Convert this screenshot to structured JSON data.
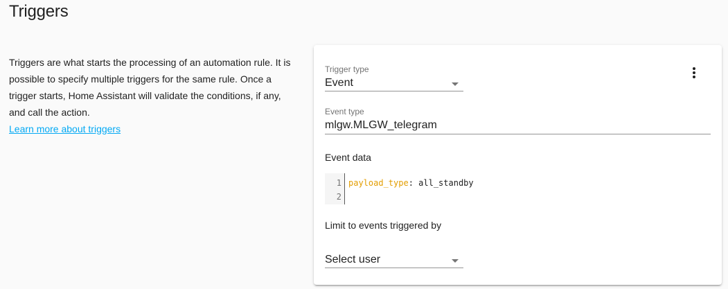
{
  "section": {
    "title": "Triggers",
    "description": "Triggers are what starts the processing of an automation rule. It is possible to specify multiple triggers for the same rule. Once a trigger starts, Home Assistant will validate the conditions, if any, and call the action.",
    "learn_more": "Learn more about triggers"
  },
  "trigger_card": {
    "menu_icon": "dots-vertical-icon",
    "trigger_type": {
      "label": "Trigger type",
      "value": "Event"
    },
    "event_type": {
      "label": "Event type",
      "value": "mlgw.MLGW_telegram"
    },
    "event_data": {
      "label": "Event data",
      "lines": [
        {
          "number": "1",
          "key": "payload_type",
          "separator": ": ",
          "value": "all_standby"
        },
        {
          "number": "2",
          "key": "",
          "separator": "",
          "value": ""
        }
      ]
    },
    "limit_users": {
      "label": "Limit to events triggered by",
      "select_placeholder": "Select user"
    }
  },
  "colors": {
    "background": "#fafafa",
    "card": "#ffffff",
    "link": "#03a9f4",
    "yaml_key": "#e39d00",
    "secondary_text": "#737373"
  }
}
